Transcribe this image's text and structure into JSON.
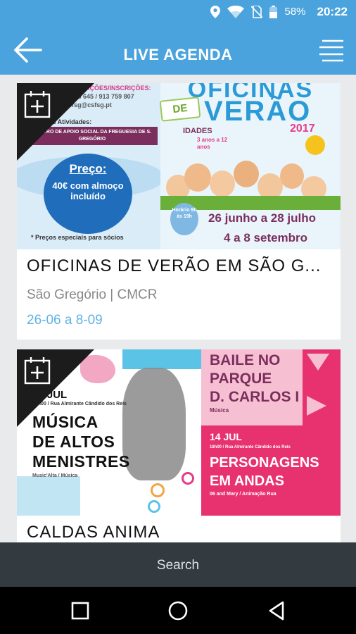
{
  "status_bar": {
    "battery": "58%",
    "time": "20:22",
    "icons": [
      "location-icon",
      "wifi-icon",
      "no-sim-icon",
      "battery-icon"
    ]
  },
  "app_bar": {
    "title": "LIVE AGENDA",
    "back_icon": "arrow-left-icon",
    "menu_icon": "hamburger-menu-icon"
  },
  "colors": {
    "accent": "#4aa3dd",
    "date": "#5fb2e3",
    "bottom_bar": "#333a40"
  },
  "events": [
    {
      "title": "OFICINAS DE VERÃO EM SÃO G...",
      "meta": "São Gregório | CMCR",
      "date": "26-06 a 8-09",
      "poster": {
        "header": "OFICINAS",
        "de": "DE",
        "brand": "VERÃO",
        "year": "2017",
        "ages_title": "IDADES",
        "ages": "3 anos a 12 anos",
        "price_label": "Preço:",
        "price_value": "40€ com almoço incluído",
        "note": "* Preços especiais para sócios",
        "dates_1": "26 junho a 28 julho",
        "dates_2": "4 a 8 setembro",
        "contact": "14 146 645 / 913 759 807",
        "email": "csfsg@csfsg.pt",
        "local_label": "Local das Atividades:",
        "venue": "CENTRO DE APOIO SOCIAL DA FREGUESIA DE S. GREGÓRIO",
        "schedule": "Horário 9h às 19h"
      }
    },
    {
      "title": "CALDAS ANIMA",
      "meta": "",
      "date": "",
      "poster": {
        "left_date": "08 JUL",
        "left_info": "18h00 / Rua Almirante Cândido dos Reis",
        "left_title_1": "MÚSICA",
        "left_title_2": "DE ALTOS",
        "left_title_3": "MENISTRES",
        "left_caption": "Music'Alta / Música",
        "right_title_1": "BAILE NO",
        "right_title_2": "PARQUE",
        "right_title_3": "D. CARLOS I",
        "right_caption": "Música",
        "right_date": "14 JUL",
        "right_info": "18h00 / Rua Almirante Cândido dos Reis",
        "right_title_4": "PERSONAGENS",
        "right_title_5": "EM ANDAS",
        "right_caption_2": "06 and Mary / Animação Rua"
      }
    }
  ],
  "bottom_bar": {
    "label": "Search"
  }
}
